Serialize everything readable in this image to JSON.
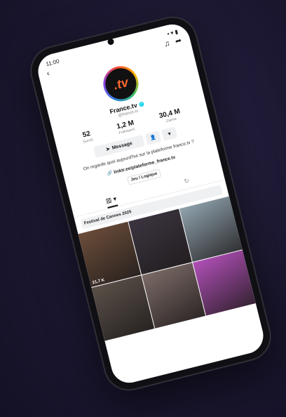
{
  "status": {
    "time": "11:00",
    "icons": "▪ ▾ ▮"
  },
  "nav": {
    "back_icon": "back-chevron-icon",
    "bell_icon": "bell-icon",
    "share_icon": "share-icon"
  },
  "profile": {
    "avatar_text": ".tv",
    "name": "France.tv",
    "handle": "@france.tv",
    "stats": [
      {
        "value": "52",
        "label": "Suivis"
      },
      {
        "value": "1,2 M",
        "label": "Followers"
      },
      {
        "value": "30,4 M",
        "label": "J'aime"
      }
    ],
    "message_label": "Message",
    "bio": "On regarde quoi aujourd'hui sur la plateforme france.tv ?",
    "link": "linktr.ee/plateforme_france.tv"
  },
  "chips": {
    "first": "Jeu / Logique"
  },
  "tabs": [
    "▥ ▾",
    "↻"
  ],
  "playlists": [
    "Festival de Cannes 2025"
  ],
  "tiles": [
    {
      "views": "21,7 K",
      "bg": "#6b4d3a"
    },
    {
      "views": "",
      "bg": "#3b3440"
    },
    {
      "views": "",
      "bg": "#8fa2ad"
    },
    {
      "views": "",
      "bg": "#5a5048"
    },
    {
      "views": "",
      "bg": "#7b6a66"
    },
    {
      "views": "",
      "bg": "#b04fb7"
    }
  ]
}
